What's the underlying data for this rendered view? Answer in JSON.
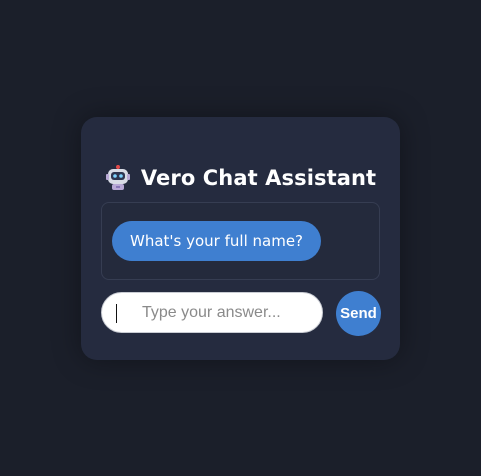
{
  "header": {
    "icon": "robot-icon",
    "title": "Vero Chat Assistant"
  },
  "chat": {
    "messages": [
      {
        "from": "assistant",
        "text": "What's your full name?"
      }
    ]
  },
  "composer": {
    "placeholder": "Type your answer...",
    "value": "",
    "send_label": "Send"
  },
  "colors": {
    "page_background": "#1b1f2a",
    "card_background": "#252b3f",
    "accent": "#3f7fd0",
    "text": "#ffffff"
  }
}
